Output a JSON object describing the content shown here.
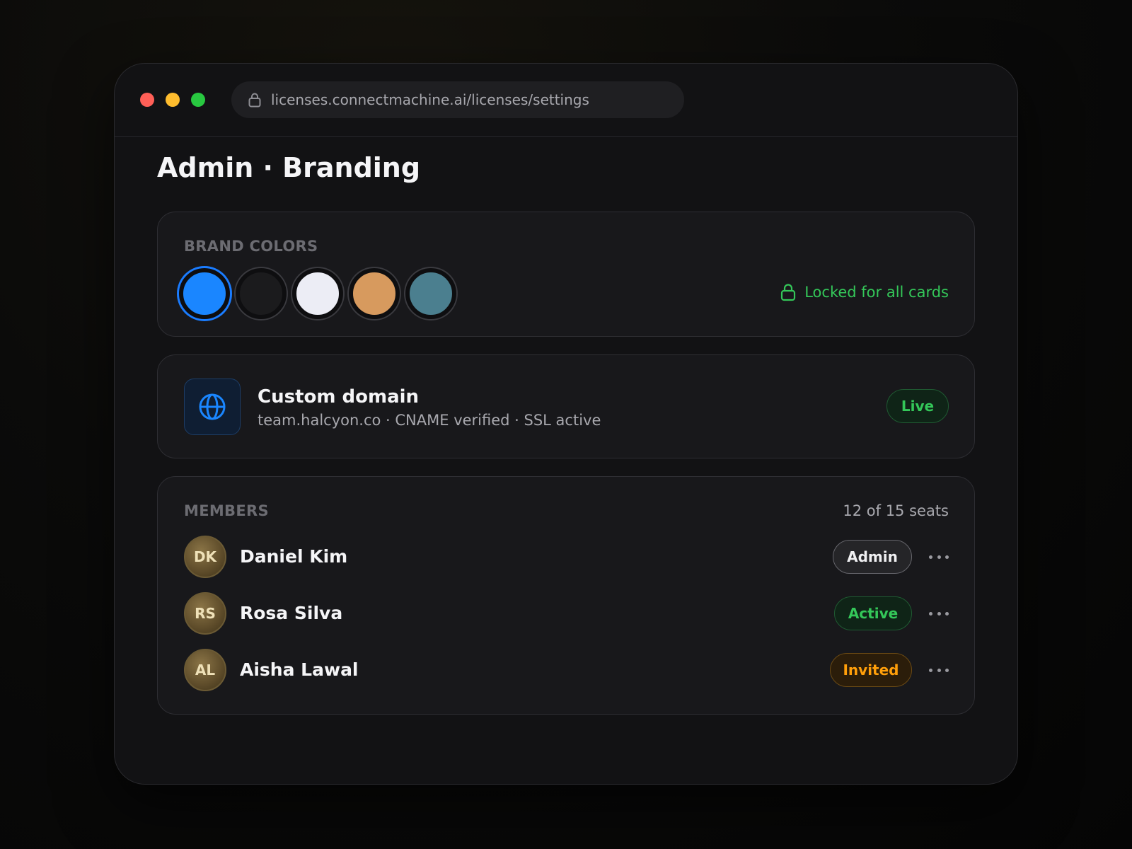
{
  "browser": {
    "url": "licenses.connectmachine.ai/licenses/settings"
  },
  "page": {
    "title": "Admin · Branding"
  },
  "brand": {
    "label": "BRAND COLORS",
    "swatches": [
      "#1a86ff",
      "#1b1b1d",
      "#ecedf5",
      "#d79a5e",
      "#4b7f8f"
    ],
    "selected_index": 0,
    "locked_text": "Locked for all cards"
  },
  "domain": {
    "title": "Custom domain",
    "subtitle": "team.halcyon.co · CNAME verified · SSL active",
    "status": "Live",
    "icon": "globe-icon"
  },
  "members": {
    "label": "MEMBERS",
    "seats": "12 of 15 seats",
    "list": [
      {
        "initials": "DK",
        "name": "Daniel Kim",
        "role": "Admin"
      },
      {
        "initials": "RS",
        "name": "Rosa Silva",
        "role": "Active"
      },
      {
        "initials": "AL",
        "name": "Aisha Lawal",
        "role": "Invited"
      }
    ]
  },
  "colors": {
    "accent": "#1a7cff",
    "success": "#34c759",
    "warning": "#ff9f0a"
  }
}
